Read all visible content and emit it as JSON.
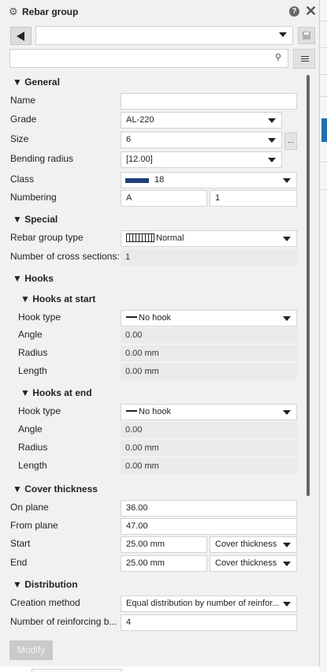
{
  "panel": {
    "title": "Rebar group",
    "settings_icon": "gear-icon",
    "help_icon": "help-icon",
    "help_glyph": "?",
    "close_icon": "close-icon",
    "close_glyph": "✕",
    "search_glyph": "⚲",
    "preset_value": "",
    "search_value": ""
  },
  "general": {
    "header": "▼ General",
    "name_label": "Name",
    "name_value": "",
    "grade_label": "Grade",
    "grade_value": "AL-220",
    "size_label": "Size",
    "size_value": "6",
    "size_more": "...",
    "bending_label": "Bending radius",
    "bending_value": "[12.00]",
    "class_label": "Class",
    "class_value": "18",
    "class_color": "#1f3f7a",
    "numbering_label": "Numbering",
    "numbering_prefix": "A",
    "numbering_start": "1"
  },
  "special": {
    "header": "▼ Special",
    "type_label": "Rebar group type",
    "type_value": "Normal",
    "cross_label": "Number of cross sections:",
    "cross_value": "1"
  },
  "hooks": {
    "header": "▼ Hooks",
    "start_header": "▼ Hooks at start",
    "start": {
      "type_label": "Hook type",
      "type_value": "No hook",
      "angle_label": "Angle",
      "angle_value": "0.00",
      "radius_label": "Radius",
      "radius_value": "0.00 mm",
      "length_label": "Length",
      "length_value": "0.00 mm"
    },
    "end_header": "▼ Hooks at end",
    "end": {
      "type_label": "Hook type",
      "type_value": "No hook",
      "angle_label": "Angle",
      "angle_value": "0.00",
      "radius_label": "Radius",
      "radius_value": "0.00 mm",
      "length_label": "Length",
      "length_value": "0.00 mm"
    }
  },
  "cover": {
    "header": "▼ Cover thickness",
    "on_plane_label": "On plane",
    "on_plane_value": "36.00",
    "from_plane_label": "From plane",
    "from_plane_value": "47.00",
    "start_label": "Start",
    "start_value": "25.00 mm",
    "start_mode": "Cover thickness",
    "end_label": "End",
    "end_value": "25.00 mm",
    "end_mode": "Cover thickness"
  },
  "distribution": {
    "header": "▼ Distribution",
    "method_label": "Creation method",
    "method_value": "Equal distribution by number of reinfor...",
    "count_label": "Number of reinforcing b...",
    "count_value": "4"
  },
  "footer": {
    "modify_label": "Modify"
  },
  "colors": {
    "accent": "#1f6fb5",
    "scrollbar": "#666666"
  }
}
